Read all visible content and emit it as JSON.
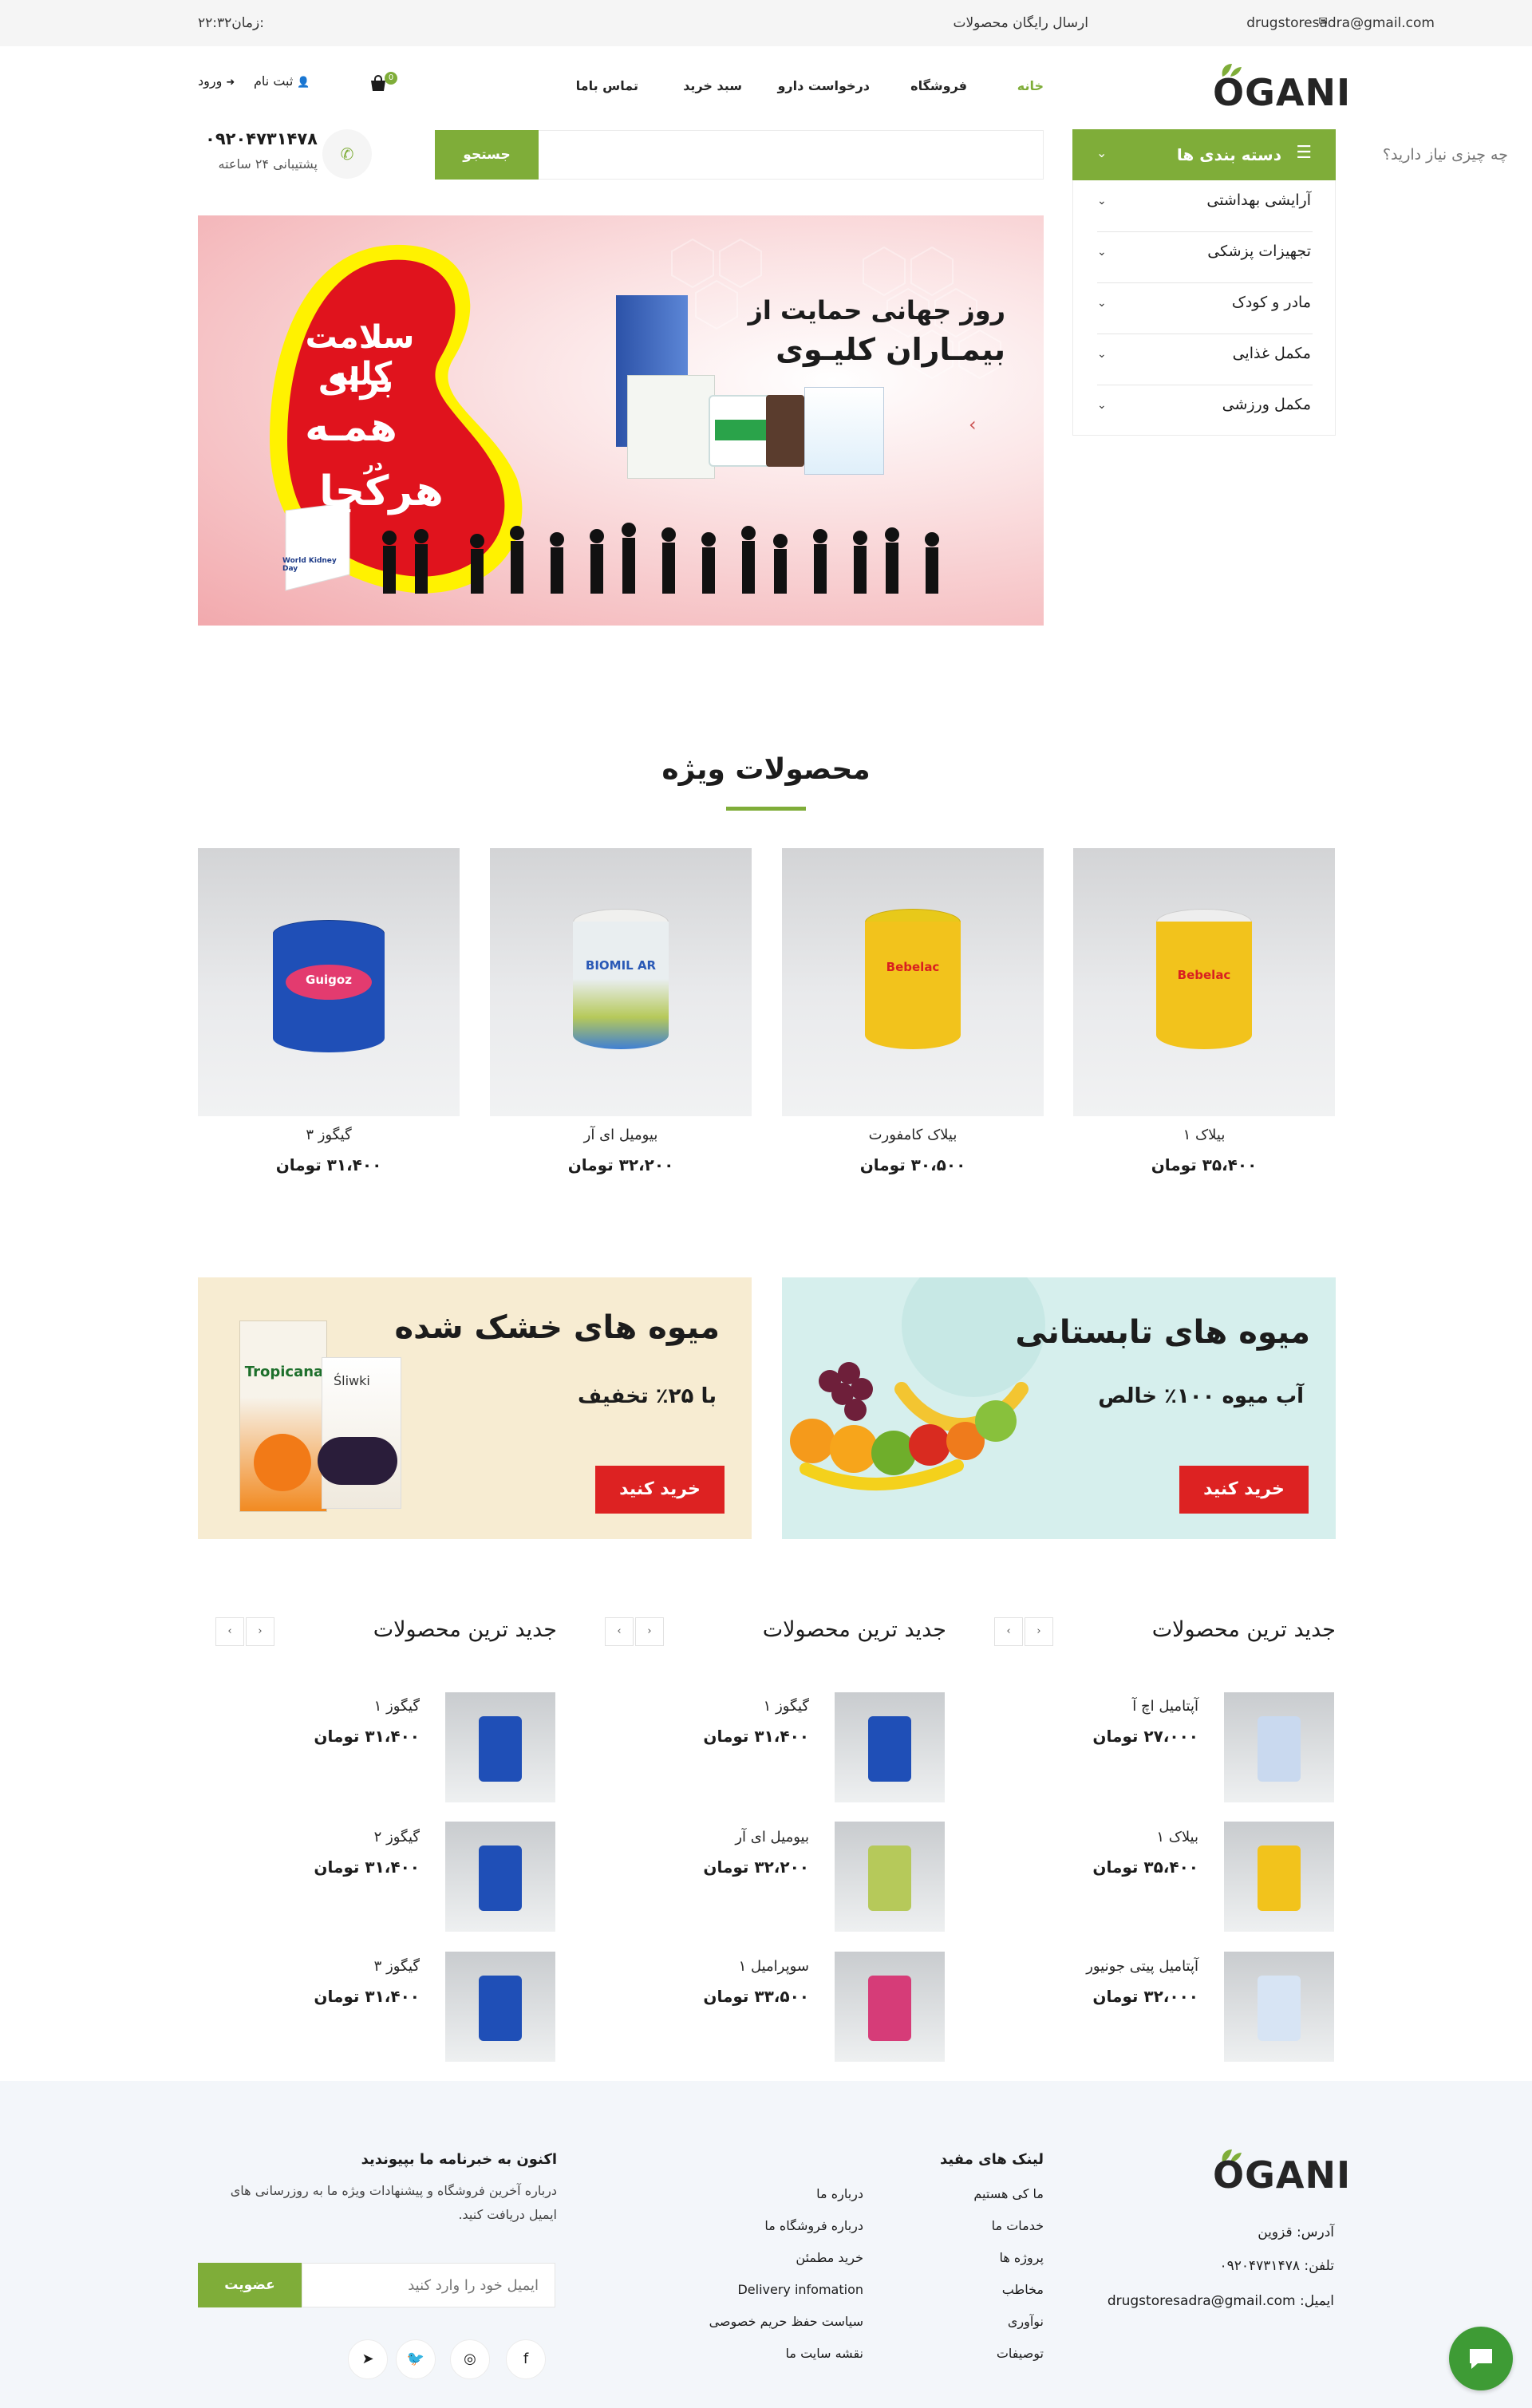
{
  "topbar": {
    "email": "drugstoresadra@gmail.com",
    "free_shipping": "ارسال رایگان محصولات",
    "time_label": "زمان:",
    "time_value": "۲۲:۳۲"
  },
  "header": {
    "logo": "OGANI",
    "nav": [
      "خانه",
      "فروشگاه",
      "درخواست دارو",
      "سبد خرید",
      "تماس باما"
    ],
    "cart_count": "0",
    "register": "ثبت نام",
    "login": "ورود"
  },
  "categories": {
    "title": "دسته بندی ها",
    "items": [
      "آرایشی بهداشتی",
      "تجهیزات پزشکی",
      "مادر و کودک",
      "مکمل غذایی",
      "مکمل ورزشی"
    ]
  },
  "search": {
    "placeholder": "چه چیزی نیاز دارید؟",
    "button": "جستجو"
  },
  "support": {
    "phone": "۰۹۲۰۴۷۳۱۴۷۸",
    "label": "پشتیبانی ۲۴ ساعته"
  },
  "banner": {
    "headline_1": "روز جهانی حمایت از",
    "headline_2": "بیمـاران کلیـوی",
    "kidney_1": "سلامت کلیه",
    "kidney_2": "برای",
    "kidney_3": "همـه",
    "kidney_4": "در",
    "kidney_5": "هرکجا",
    "badge": "World Kidney Day"
  },
  "featured": {
    "title": "محصولات ویژه",
    "products": [
      {
        "name": "بیلاک ۱",
        "price": "۳۵،۴۰۰ تومان",
        "brand": "Bebelac",
        "lid": "#f4f4f4",
        "body": "#f2c31c"
      },
      {
        "name": "بیلاک کامفورت",
        "price": "۳۰،۵۰۰ تومان",
        "brand": "Bebelac",
        "lid": "#e8c91a",
        "body": "#f2c31c"
      },
      {
        "name": "بیومیل ای آر",
        "price": "۳۲،۲۰۰ تومان",
        "brand": "BIOMIL AR",
        "lid": "#f0f0ee",
        "body": "#e9eef0"
      },
      {
        "name": "گیگوز ۳",
        "price": "۳۱،۴۰۰ تومان",
        "brand": "Guigoz",
        "lid": "#1f4fb7",
        "body": "#1f4fb7"
      }
    ]
  },
  "promos": [
    {
      "title": "میوه های تابستانی",
      "subtitle": "آب میوه ۱۰۰٪ خالص",
      "button": "خرید کنید",
      "bg": "#d6efed"
    },
    {
      "title": "میوه های خشک شده",
      "subtitle": "با ۲۵٪ تخفیف",
      "button": "خرید کنید",
      "bg": "#f7ecd2"
    }
  ],
  "latest": [
    {
      "title": "جدید ترین محصولات",
      "items": [
        {
          "name": "آپتامیل اچ آ",
          "price": "۲۷،۰۰۰ تومان",
          "color": "#c9d9ef"
        },
        {
          "name": "بیلاک ۱",
          "price": "۳۵،۴۰۰ تومان",
          "color": "#f2c31c"
        },
        {
          "name": "آپتامیل پیتی جونیور",
          "price": "۳۲،۰۰۰ تومان",
          "color": "#d7e4f4"
        }
      ]
    },
    {
      "title": "جدید ترین محصولات",
      "items": [
        {
          "name": "گیگوز ۱",
          "price": "۳۱،۴۰۰ تومان",
          "color": "#1f4fb7"
        },
        {
          "name": "بیومیل ای آر",
          "price": "۳۲،۲۰۰ تومان",
          "color": "#b6c95a"
        },
        {
          "name": "سوپرامیل ۱",
          "price": "۳۳،۵۰۰ تومان",
          "color": "#d63c78"
        }
      ]
    },
    {
      "title": "جدید ترین محصولات",
      "items": [
        {
          "name": "گیگوز ۱",
          "price": "۳۱،۴۰۰ تومان",
          "color": "#1f4fb7"
        },
        {
          "name": "گیگوز ۲",
          "price": "۳۱،۴۰۰ تومان",
          "color": "#1f4fb7"
        },
        {
          "name": "گیگوز ۳",
          "price": "۳۱،۴۰۰ تومان",
          "color": "#1f4fb7"
        }
      ]
    }
  ],
  "footer": {
    "logo": "OGANI",
    "address": "آدرس: قزوین",
    "phone": "تلفن: ۰۹۲۰۴۷۳۱۴۷۸",
    "email": "ایمیل: drugstoresadra@gmail.com",
    "links_title": "لینک های مفید",
    "links_col1": [
      "ما کی هستیم",
      "خدمات ما",
      "پروژه ها",
      "مخاطب",
      "نوآوری",
      "توصیفات"
    ],
    "links_col2": [
      "درباره ما",
      "درباره فروشگاه ما",
      "خرید مطمئن",
      "Delivery infomation",
      "سیاست حفظ حریم خصوصی",
      "نقشه سایت ما"
    ],
    "newsletter_title": "اکنون به خبرنامه ما بپیوندید",
    "newsletter_text_1": "درباره آخرین فروشگاه و پیشنهادات ویژه ما به روزرسانی های",
    "newsletter_text_2": "ایمیل دریافت کنید.",
    "email_placeholder": "ایمیل خود را وارد کنید",
    "subscribe": "عضویت"
  },
  "colors": {
    "accent": "#7fad39",
    "promo_button": "#dd2222",
    "footer_bg": "#f3f6fa",
    "chat": "#3e9b35"
  }
}
